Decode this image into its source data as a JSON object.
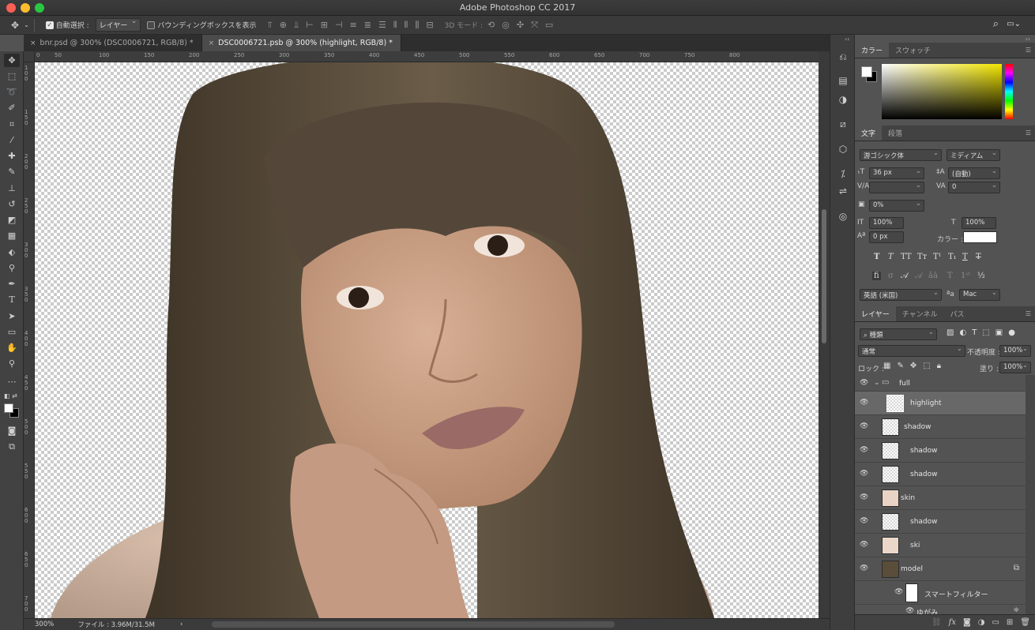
{
  "window": {
    "title": "Adobe Photoshop CC 2017"
  },
  "options_bar": {
    "auto_select_label": "自動選択 :",
    "auto_select_target": "レイヤー",
    "bounding_box_label": "バウンディングボックスを表示",
    "mode_3d_label": "3D モード :"
  },
  "doc_tabs": [
    {
      "label": "bnr.psd @ 300% (DSC0006721, RGB/8) *",
      "close": "×"
    },
    {
      "label": "DSC0006721.psb @ 300% (highlight, RGB/8) *",
      "close": "×"
    }
  ],
  "ruler": {
    "top_labels": [
      "0",
      "50",
      "100",
      "150",
      "200",
      "250",
      "300",
      "350",
      "400",
      "450",
      "500",
      "550",
      "600",
      "650",
      "700",
      "750",
      "800"
    ],
    "left_labels": [
      "100",
      "150",
      "200",
      "250",
      "300",
      "350",
      "400",
      "450",
      "500",
      "550",
      "600",
      "650",
      "700"
    ]
  },
  "status": {
    "zoom": "300%",
    "file_info": "ファイル : 3.96M/31.5M",
    "arrow": "›"
  },
  "color_panel": {
    "tabs": [
      "カラー",
      "スウォッチ"
    ]
  },
  "type_panel": {
    "tabs": [
      "文字",
      "段落"
    ],
    "font_family": "游ゴシック体",
    "font_style": "ミディアム",
    "size": "36 px",
    "leading": "(自動)",
    "kerning": "",
    "tracking": "0",
    "tsume": "0%",
    "vertical_scale": "100%",
    "horizontal_scale": "100%",
    "baseline": "0 px",
    "color_label": "カラー :",
    "language": "英語 (米国)",
    "antialias": "Mac",
    "aa_label": "ªa"
  },
  "layers_panel": {
    "tabs": [
      "レイヤー",
      "チャンネル",
      "パス"
    ],
    "filter_kind": "種類",
    "blend_mode": "通常",
    "opacity_label": "不透明度 :",
    "opacity": "100%",
    "lock_label": "ロック :",
    "fill_label": "塗り :",
    "fill": "100%",
    "group_name": "full",
    "layers": [
      {
        "name": "highlight",
        "selected": true
      },
      {
        "name": "shadow",
        "selected": false
      },
      {
        "name": "shadow",
        "selected": false
      },
      {
        "name": "shadow",
        "selected": false
      },
      {
        "name": "skin",
        "selected": false
      },
      {
        "name": "shadow",
        "selected": false
      },
      {
        "name": "ski",
        "selected": false
      },
      {
        "name": "model",
        "selected": false
      }
    ],
    "smart_filter_label": "スマートフィルター",
    "sub_filter_label": "ゆがみ",
    "bottom_icons": [
      "link-icon",
      "fx-icon",
      "mask-icon",
      "adjustment-icon",
      "folder-icon",
      "new-layer-icon",
      "trash-icon"
    ],
    "fx_label": "fx"
  },
  "colors": {
    "bg_ui": "#535353",
    "hair": "#5a4d3a",
    "skin": "#c9a084",
    "text_color_swatch": "#ffffff"
  }
}
